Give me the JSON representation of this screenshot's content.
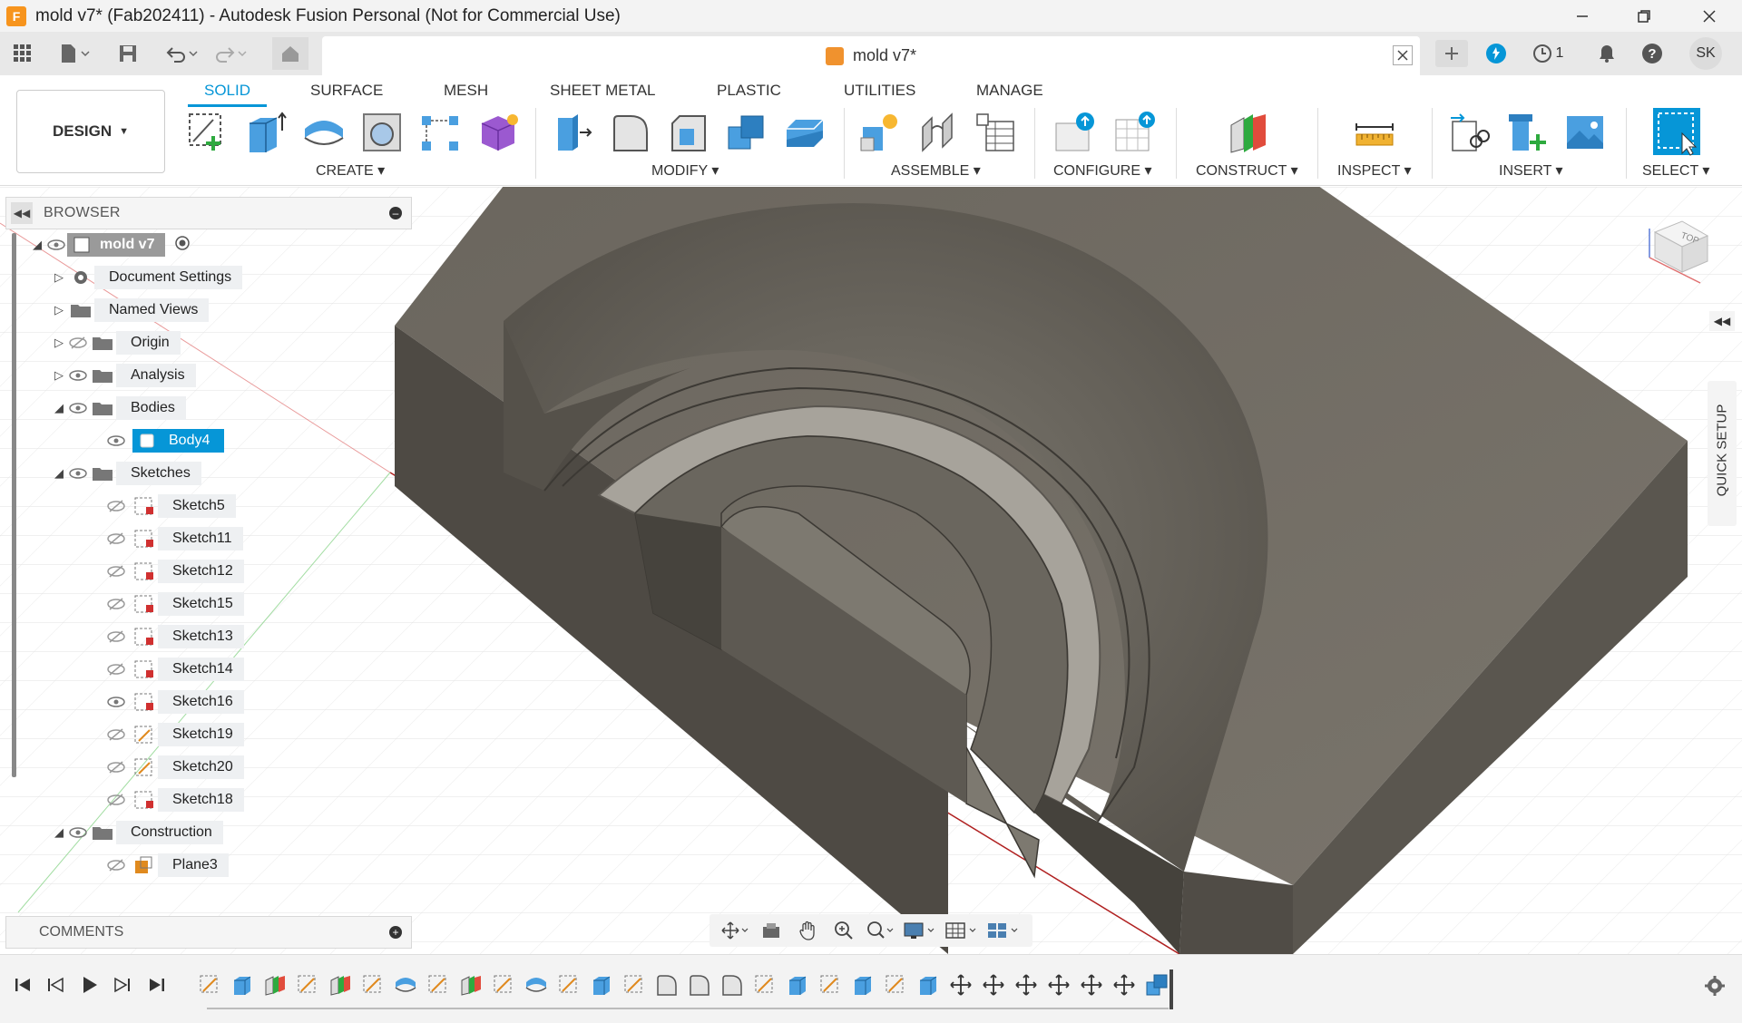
{
  "window": {
    "title": "mold v7* (Fab202411) - Autodesk Fusion Personal (Not for Commercial Use)",
    "app_icon_letter": "F",
    "controls": [
      "minimize",
      "restore",
      "close"
    ]
  },
  "quick_access": {
    "doc_tab_title": "mold v7*",
    "job_count": "1",
    "user_initials": "SK"
  },
  "toolbar": {
    "workspace": "DESIGN",
    "tabs": [
      "SOLID",
      "SURFACE",
      "MESH",
      "SHEET METAL",
      "PLASTIC",
      "UTILITIES",
      "MANAGE"
    ],
    "active_tab": "SOLID",
    "groups": {
      "create": "CREATE",
      "modify": "MODIFY",
      "assemble": "ASSEMBLE",
      "configure": "CONFIGURE",
      "construct": "CONSTRUCT",
      "inspect": "INSPECT",
      "insert": "INSERT",
      "select": "SELECT"
    }
  },
  "browser": {
    "title": "BROWSER",
    "root": "mold v7",
    "items": [
      {
        "label": "Document Settings"
      },
      {
        "label": "Named Views"
      },
      {
        "label": "Origin"
      },
      {
        "label": "Analysis"
      },
      {
        "label": "Bodies"
      },
      {
        "label": "Body4"
      },
      {
        "label": "Sketches"
      },
      {
        "label": "Sketch5"
      },
      {
        "label": "Sketch11"
      },
      {
        "label": "Sketch12"
      },
      {
        "label": "Sketch15"
      },
      {
        "label": "Sketch13"
      },
      {
        "label": "Sketch14"
      },
      {
        "label": "Sketch16"
      },
      {
        "label": "Sketch19"
      },
      {
        "label": "Sketch20"
      },
      {
        "label": "Sketch18"
      },
      {
        "label": "Construction"
      },
      {
        "label": "Plane3"
      }
    ]
  },
  "comments": {
    "title": "COMMENTS"
  },
  "viewcube": {
    "face": "TOP"
  },
  "quick_setup": {
    "label": "QUICK SETUP"
  },
  "colors": {
    "accent": "#0696d7",
    "model_body": "#6f6a62",
    "selection": "#0696d7"
  }
}
